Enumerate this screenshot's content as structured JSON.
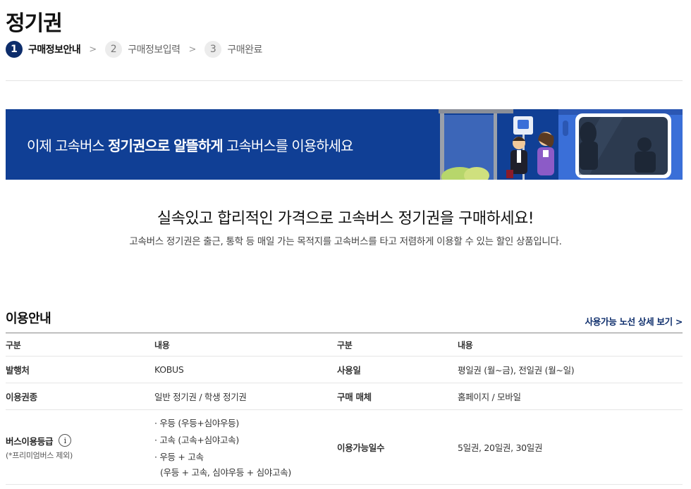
{
  "page": {
    "title": "정기권"
  },
  "steps": [
    {
      "num": "1",
      "label": "구매정보안내"
    },
    {
      "num": "2",
      "label": "구매정보입력"
    },
    {
      "num": "3",
      "label": "구매완료"
    }
  ],
  "step_separator": ">",
  "banner": {
    "text_1": "이제 고속버스 ",
    "text_bold_1": "정기권으로 알뜰하게",
    "text_2": " 고속버스를 이용하세요"
  },
  "intro": {
    "headline": "실속있고 합리적인 가격으로 고속버스 정기권을 구매하세요!",
    "description": "고속버스 정기권은 출근, 통학 등 매일 가는 목적지를 고속버스를 타고 저렴하게 이용할 수 있는 할인 상품입니다."
  },
  "usage_section": {
    "title": "이용안내",
    "route_link": "사용가능 노선 상세 보기 >"
  },
  "table": {
    "headers": [
      "구분",
      "내용",
      "구분",
      "내용"
    ],
    "rows": [
      {
        "k1": "발행처",
        "v1": "KOBUS",
        "k2": "사용일",
        "v2": "평일권 (월~금), 전일권 (월~일)"
      },
      {
        "k1": "이용권종",
        "v1": "일반 정기권 / 학생 정기권",
        "k2": "구매 매체",
        "v2": "홈페이지 / 모바일"
      }
    ],
    "grade_row": {
      "k1": "버스이용등급",
      "k1_note": "(*프리미엄버스 제외)",
      "info_icon_glyph": "i",
      "items": [
        "· 우등 (우등+심야우등)",
        "· 고속 (고속+심야고속)",
        "· 우등 + 고속"
      ],
      "items_sub": "(우등 + 고속, 심야우등 + 심야고속)",
      "k2": "이용가능일수",
      "v2": "5일권, 20일권, 30일권"
    }
  },
  "icons": {
    "info": "info-circle-icon",
    "chevron": "chevron-right-icon"
  },
  "colors": {
    "brand_navy": "#0d2d6b",
    "banner_blue": "#103f95",
    "bus_blue": "#3a6fd8"
  }
}
